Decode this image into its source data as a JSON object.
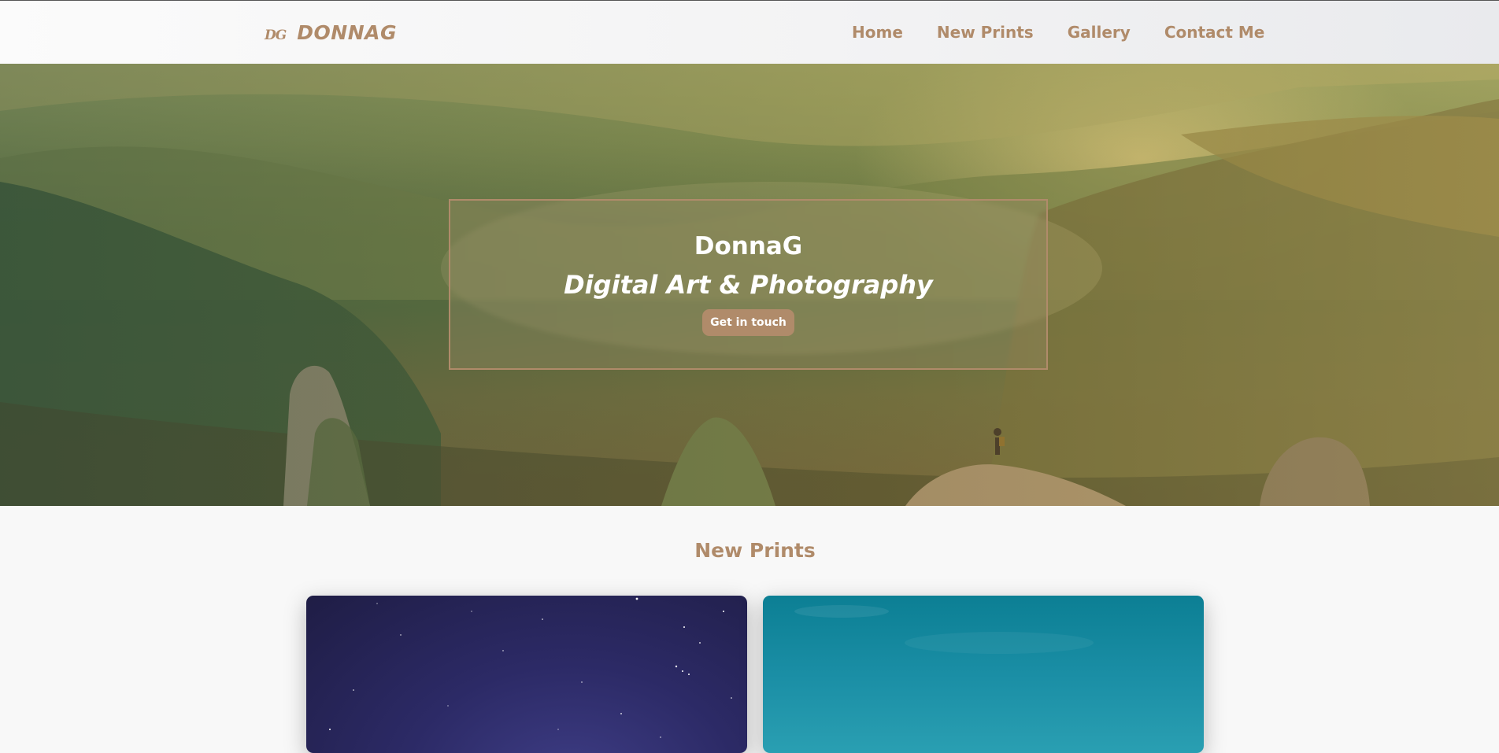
{
  "header": {
    "logo_mark": "DG",
    "logo_text": "DONNAG",
    "nav": [
      {
        "label": "Home"
      },
      {
        "label": "New Prints"
      },
      {
        "label": "Gallery"
      },
      {
        "label": "Contact Me"
      }
    ]
  },
  "hero": {
    "title": "DonnaG",
    "subtitle": "Digital Art & Photography",
    "cta_label": "Get in touch"
  },
  "new_prints": {
    "title": "New Prints"
  },
  "colors": {
    "accent": "#b08b6a",
    "background": "#f8f8f8"
  }
}
